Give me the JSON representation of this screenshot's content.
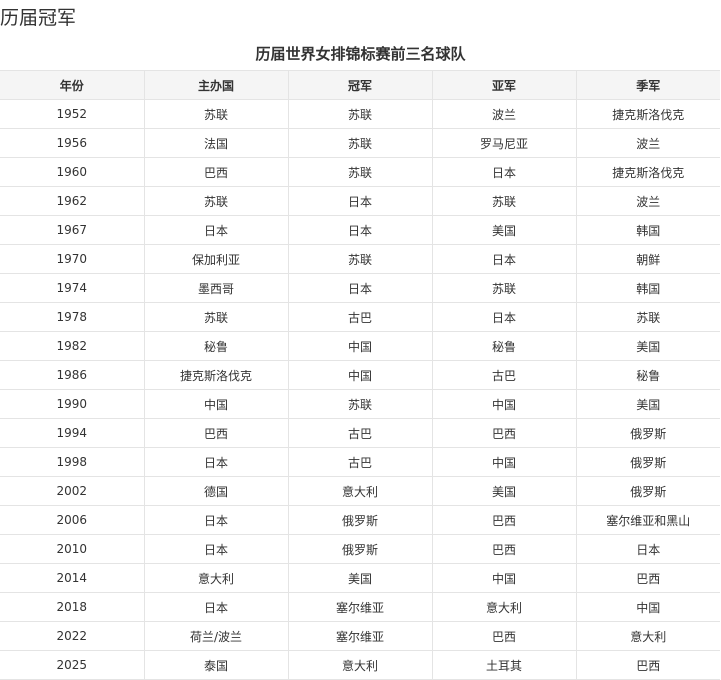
{
  "page": {
    "heading": "历届冠军",
    "table_title": "历届世界女排锦标赛前三名球队"
  },
  "table": {
    "headers": [
      "年份",
      "主办国",
      "冠军",
      "亚军",
      "季军"
    ],
    "rows": [
      [
        "1952",
        "苏联",
        "苏联",
        "波兰",
        "捷克斯洛伐克"
      ],
      [
        "1956",
        "法国",
        "苏联",
        "罗马尼亚",
        "波兰"
      ],
      [
        "1960",
        "巴西",
        "苏联",
        "日本",
        "捷克斯洛伐克"
      ],
      [
        "1962",
        "苏联",
        "日本",
        "苏联",
        "波兰"
      ],
      [
        "1967",
        "日本",
        "日本",
        "美国",
        "韩国"
      ],
      [
        "1970",
        "保加利亚",
        "苏联",
        "日本",
        "朝鲜"
      ],
      [
        "1974",
        "墨西哥",
        "日本",
        "苏联",
        "韩国"
      ],
      [
        "1978",
        "苏联",
        "古巴",
        "日本",
        "苏联"
      ],
      [
        "1982",
        "秘鲁",
        "中国",
        "秘鲁",
        "美国"
      ],
      [
        "1986",
        "捷克斯洛伐克",
        "中国",
        "古巴",
        "秘鲁"
      ],
      [
        "1990",
        "中国",
        "苏联",
        "中国",
        "美国"
      ],
      [
        "1994",
        "巴西",
        "古巴",
        "巴西",
        "俄罗斯"
      ],
      [
        "1998",
        "日本",
        "古巴",
        "中国",
        "俄罗斯"
      ],
      [
        "2002",
        "德国",
        "意大利",
        "美国",
        "俄罗斯"
      ],
      [
        "2006",
        "日本",
        "俄罗斯",
        "巴西",
        "塞尔维亚和黑山"
      ],
      [
        "2010",
        "日本",
        "俄罗斯",
        "巴西",
        "日本"
      ],
      [
        "2014",
        "意大利",
        "美国",
        "中国",
        "巴西"
      ],
      [
        "2018",
        "日本",
        "塞尔维亚",
        "意大利",
        "中国"
      ],
      [
        "2022",
        "荷兰/波兰",
        "塞尔维亚",
        "巴西",
        "意大利"
      ],
      [
        "2025",
        "泰国",
        "意大利",
        "土耳其",
        "巴西"
      ]
    ]
  }
}
